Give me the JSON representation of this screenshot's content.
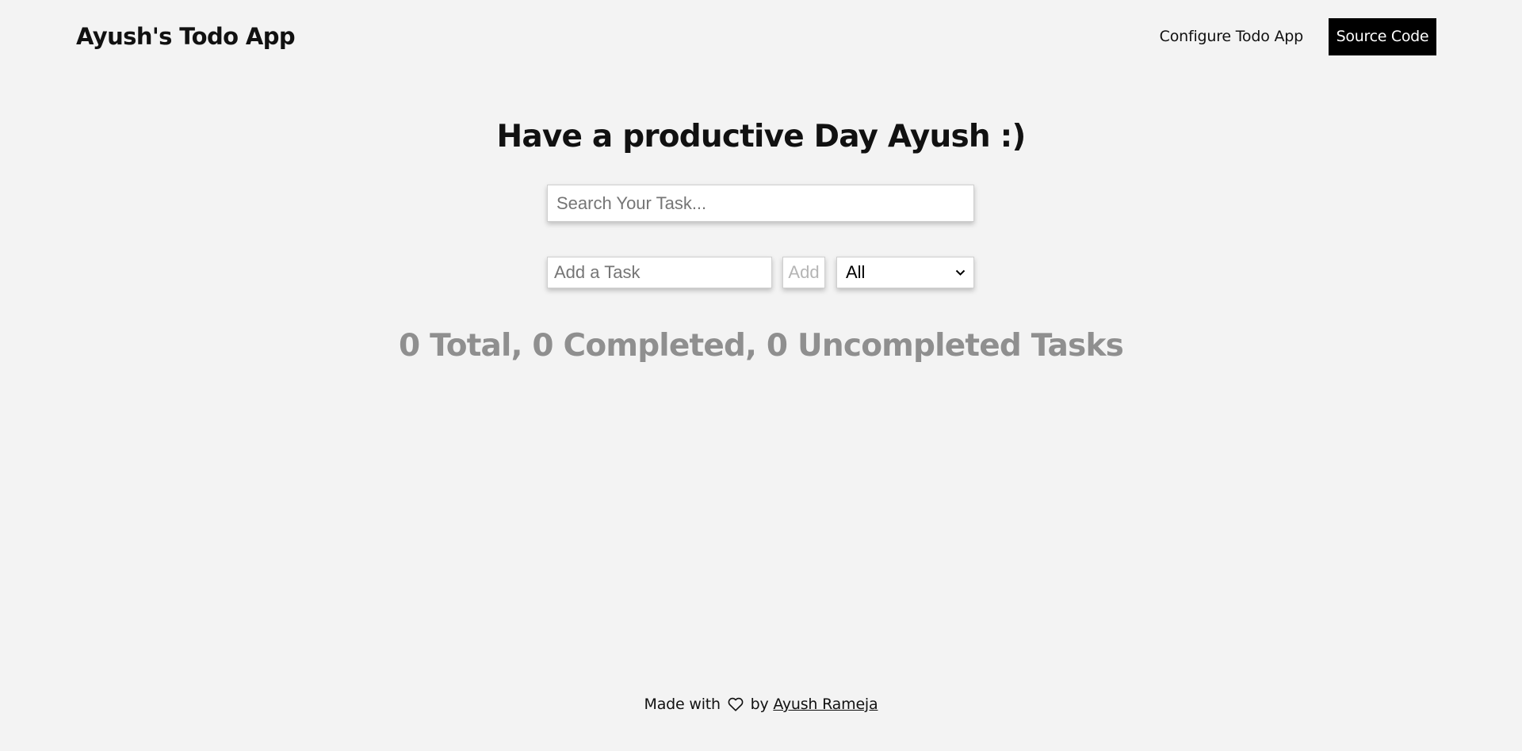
{
  "header": {
    "brand": "Ayush's Todo App",
    "configure_link": "Configure Todo App",
    "source_button": "Source Code"
  },
  "main": {
    "greeting": "Have a productive Day Ayush :)",
    "search_placeholder": "Search Your Task...",
    "add_placeholder": "Add a Task",
    "add_button": "Add",
    "filter_selected": "All",
    "stats": "0 Total, 0 Completed, 0 Uncompleted Tasks"
  },
  "footer": {
    "made_with": "Made with",
    "by": "by",
    "author": "Ayush Rameja",
    "heart_icon": "heart-icon"
  },
  "colors": {
    "background": "#f3f3f3",
    "source_button_bg": "#000000",
    "stats_text": "#8f8f8f"
  }
}
